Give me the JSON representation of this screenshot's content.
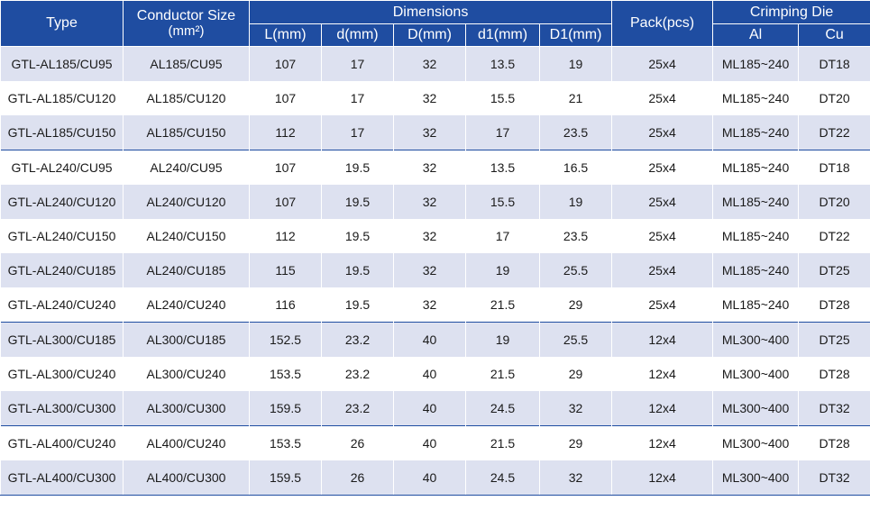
{
  "header": {
    "type": "Type",
    "conductor_size": "Conductor Size",
    "conductor_unit": "(mm²)",
    "dimensions": "Dimensions",
    "pack": "Pack(pcs)",
    "crimping_die": "Crimping Die",
    "cols": {
      "L": "L(mm)",
      "d": "d(mm)",
      "D": "D(mm)",
      "d1": "d1(mm)",
      "D1": "D1(mm)",
      "al": "Al",
      "cu": "Cu"
    }
  },
  "rows": [
    {
      "type": "GTL-AL185/CU95",
      "size": "AL185/CU95",
      "L": "107",
      "d": "17",
      "D": "32",
      "d1": "13.5",
      "D1": "19",
      "pack": "25x4",
      "al": "ML185~240",
      "cu": "DT18"
    },
    {
      "type": "GTL-AL185/CU120",
      "size": "AL185/CU120",
      "L": "107",
      "d": "17",
      "D": "32",
      "d1": "15.5",
      "D1": "21",
      "pack": "25x4",
      "al": "ML185~240",
      "cu": "DT20"
    },
    {
      "type": "GTL-AL185/CU150",
      "size": "AL185/CU150",
      "L": "112",
      "d": "17",
      "D": "32",
      "d1": "17",
      "D1": "23.5",
      "pack": "25x4",
      "al": "ML185~240",
      "cu": "DT22"
    },
    {
      "type": "GTL-AL240/CU95",
      "size": "AL240/CU95",
      "L": "107",
      "d": "19.5",
      "D": "32",
      "d1": "13.5",
      "D1": "16.5",
      "pack": "25x4",
      "al": "ML185~240",
      "cu": "DT18"
    },
    {
      "type": "GTL-AL240/CU120",
      "size": "AL240/CU120",
      "L": "107",
      "d": "19.5",
      "D": "32",
      "d1": "15.5",
      "D1": "19",
      "pack": "25x4",
      "al": "ML185~240",
      "cu": "DT20"
    },
    {
      "type": "GTL-AL240/CU150",
      "size": "AL240/CU150",
      "L": "112",
      "d": "19.5",
      "D": "32",
      "d1": "17",
      "D1": "23.5",
      "pack": "25x4",
      "al": "ML185~240",
      "cu": "DT22"
    },
    {
      "type": "GTL-AL240/CU185",
      "size": "AL240/CU185",
      "L": "115",
      "d": "19.5",
      "D": "32",
      "d1": "19",
      "D1": "25.5",
      "pack": "25x4",
      "al": "ML185~240",
      "cu": "DT25"
    },
    {
      "type": "GTL-AL240/CU240",
      "size": "AL240/CU240",
      "L": "116",
      "d": "19.5",
      "D": "32",
      "d1": "21.5",
      "D1": "29",
      "pack": "25x4",
      "al": "ML185~240",
      "cu": "DT28"
    },
    {
      "type": "GTL-AL300/CU185",
      "size": "AL300/CU185",
      "L": "152.5",
      "d": "23.2",
      "D": "40",
      "d1": "19",
      "D1": "25.5",
      "pack": "12x4",
      "al": "ML300~400",
      "cu": "DT25"
    },
    {
      "type": "GTL-AL300/CU240",
      "size": "AL300/CU240",
      "L": "153.5",
      "d": "23.2",
      "D": "40",
      "d1": "21.5",
      "D1": "29",
      "pack": "12x4",
      "al": "ML300~400",
      "cu": "DT28"
    },
    {
      "type": "GTL-AL300/CU300",
      "size": "AL300/CU300",
      "L": "159.5",
      "d": "23.2",
      "D": "40",
      "d1": "24.5",
      "D1": "32",
      "pack": "12x4",
      "al": "ML300~400",
      "cu": "DT32"
    },
    {
      "type": "GTL-AL400/CU240",
      "size": "AL400/CU240",
      "L": "153.5",
      "d": "26",
      "D": "40",
      "d1": "21.5",
      "D1": "29",
      "pack": "12x4",
      "al": "ML300~400",
      "cu": "DT28"
    },
    {
      "type": "GTL-AL400/CU300",
      "size": "AL400/CU300",
      "L": "159.5",
      "d": "26",
      "D": "40",
      "d1": "24.5",
      "D1": "32",
      "pack": "12x4",
      "al": "ML300~400",
      "cu": "DT32"
    }
  ],
  "colors": {
    "header_bg": "#1f4da1",
    "stripe_bg": "#dde1f0",
    "plain_bg": "#ffffff"
  }
}
